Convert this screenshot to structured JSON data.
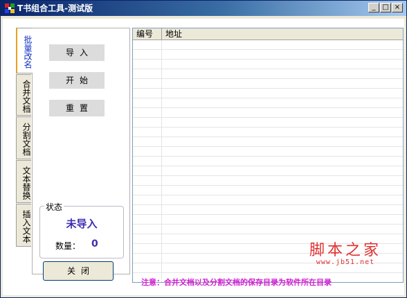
{
  "window": {
    "title": "T书组合工具-测试版",
    "controls": {
      "minimize": "_",
      "maximize": "□",
      "close": "×"
    }
  },
  "tabs": [
    {
      "label": "批量改名",
      "active": true
    },
    {
      "label": "合并文档",
      "active": false
    },
    {
      "label": "分割文档",
      "active": false
    },
    {
      "label": "文本替换",
      "active": false
    },
    {
      "label": "插入文本",
      "active": false
    }
  ],
  "actions": {
    "import": "导入",
    "start": "开始",
    "reset": "重置"
  },
  "status": {
    "legend": "状态",
    "value": "未导入",
    "count_label": "数量：",
    "count_value": "0"
  },
  "close_button": "关闭",
  "list": {
    "columns": [
      "编号",
      "地址"
    ]
  },
  "note": "注意：合并文档以及分割文档的保存目录为软件所在目录",
  "watermark": {
    "text": "脚本之家",
    "url": "www.jb51.net"
  },
  "colors": {
    "status_text": "#3c2fb0",
    "note_text": "#d020d0",
    "titlebar": "#0a246a"
  }
}
